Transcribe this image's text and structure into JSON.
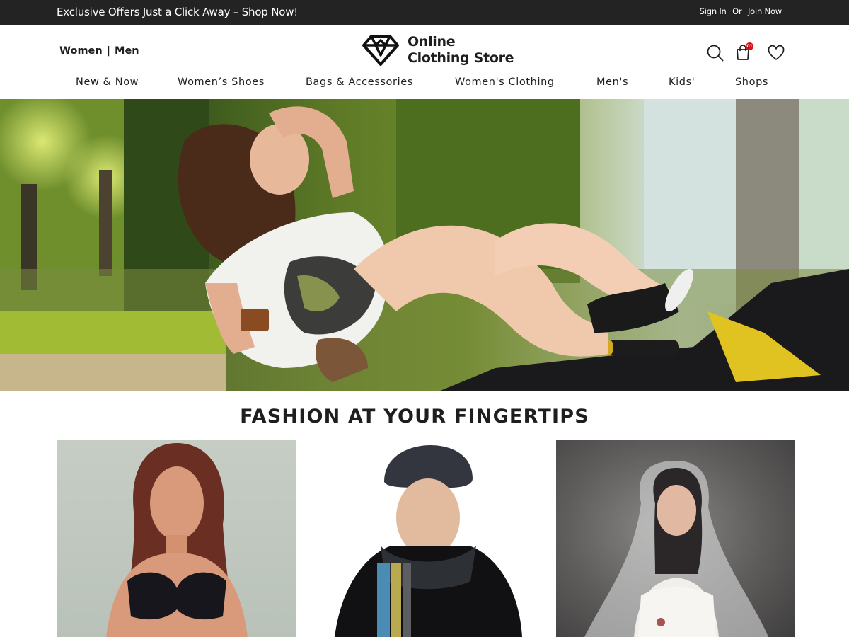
{
  "topbar": {
    "promo": "Exclusive Offers Just a Click Away – Shop Now!",
    "sign_in": "Sign In",
    "or": "Or",
    "join_now": "Join Now"
  },
  "header": {
    "gender_links": [
      "Women",
      "Men"
    ],
    "gender_separator": "|",
    "brand_line1": "Online",
    "brand_line2": "Clothing Store",
    "cart_count": "01",
    "icons": [
      "search-icon",
      "shopping-bag-icon",
      "heart-icon"
    ]
  },
  "nav": {
    "items": [
      "New & Now",
      "Women’s Shoes",
      "Bags & Accessories",
      "Women's Clothing",
      "Men's",
      "Kids'",
      "Shops"
    ]
  },
  "main": {
    "section_title": "FASHION AT YOUR FINGERTIPS"
  },
  "colors": {
    "topbar_bg": "#232323",
    "text": "#1e1e1e",
    "badge": "#d3121b",
    "page_bg": "#ffffff"
  }
}
